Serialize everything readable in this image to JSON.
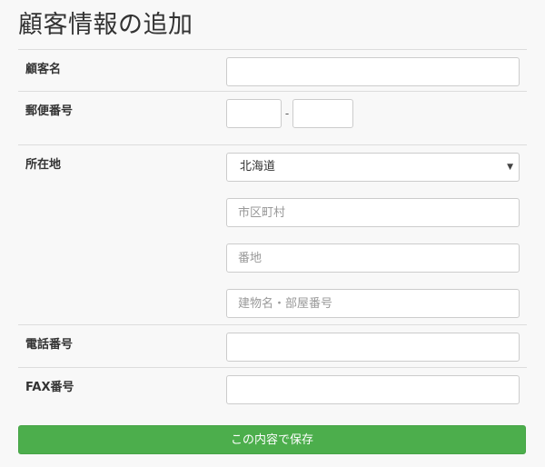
{
  "page": {
    "title": "顧客情報の追加"
  },
  "form": {
    "customer_name": {
      "label": "顧客名",
      "value": "",
      "placeholder": ""
    },
    "postal_code": {
      "label": "郵便番号",
      "part1": "",
      "part2": "",
      "separator": "-"
    },
    "address": {
      "label": "所在地",
      "prefecture": {
        "selected": "北海道"
      },
      "city": {
        "placeholder": "市区町村"
      },
      "street": {
        "placeholder": "番地"
      },
      "building": {
        "placeholder": "建物名・部屋番号"
      }
    },
    "phone": {
      "label": "電話番号",
      "value": ""
    },
    "fax": {
      "label": "FAX番号",
      "value": ""
    }
  },
  "actions": {
    "save_label": "この内容で保存"
  },
  "icons": {
    "select_caret": "caret-down-icon"
  },
  "colors": {
    "save_button": "#4cae4c",
    "background": "#f8f8f8"
  }
}
